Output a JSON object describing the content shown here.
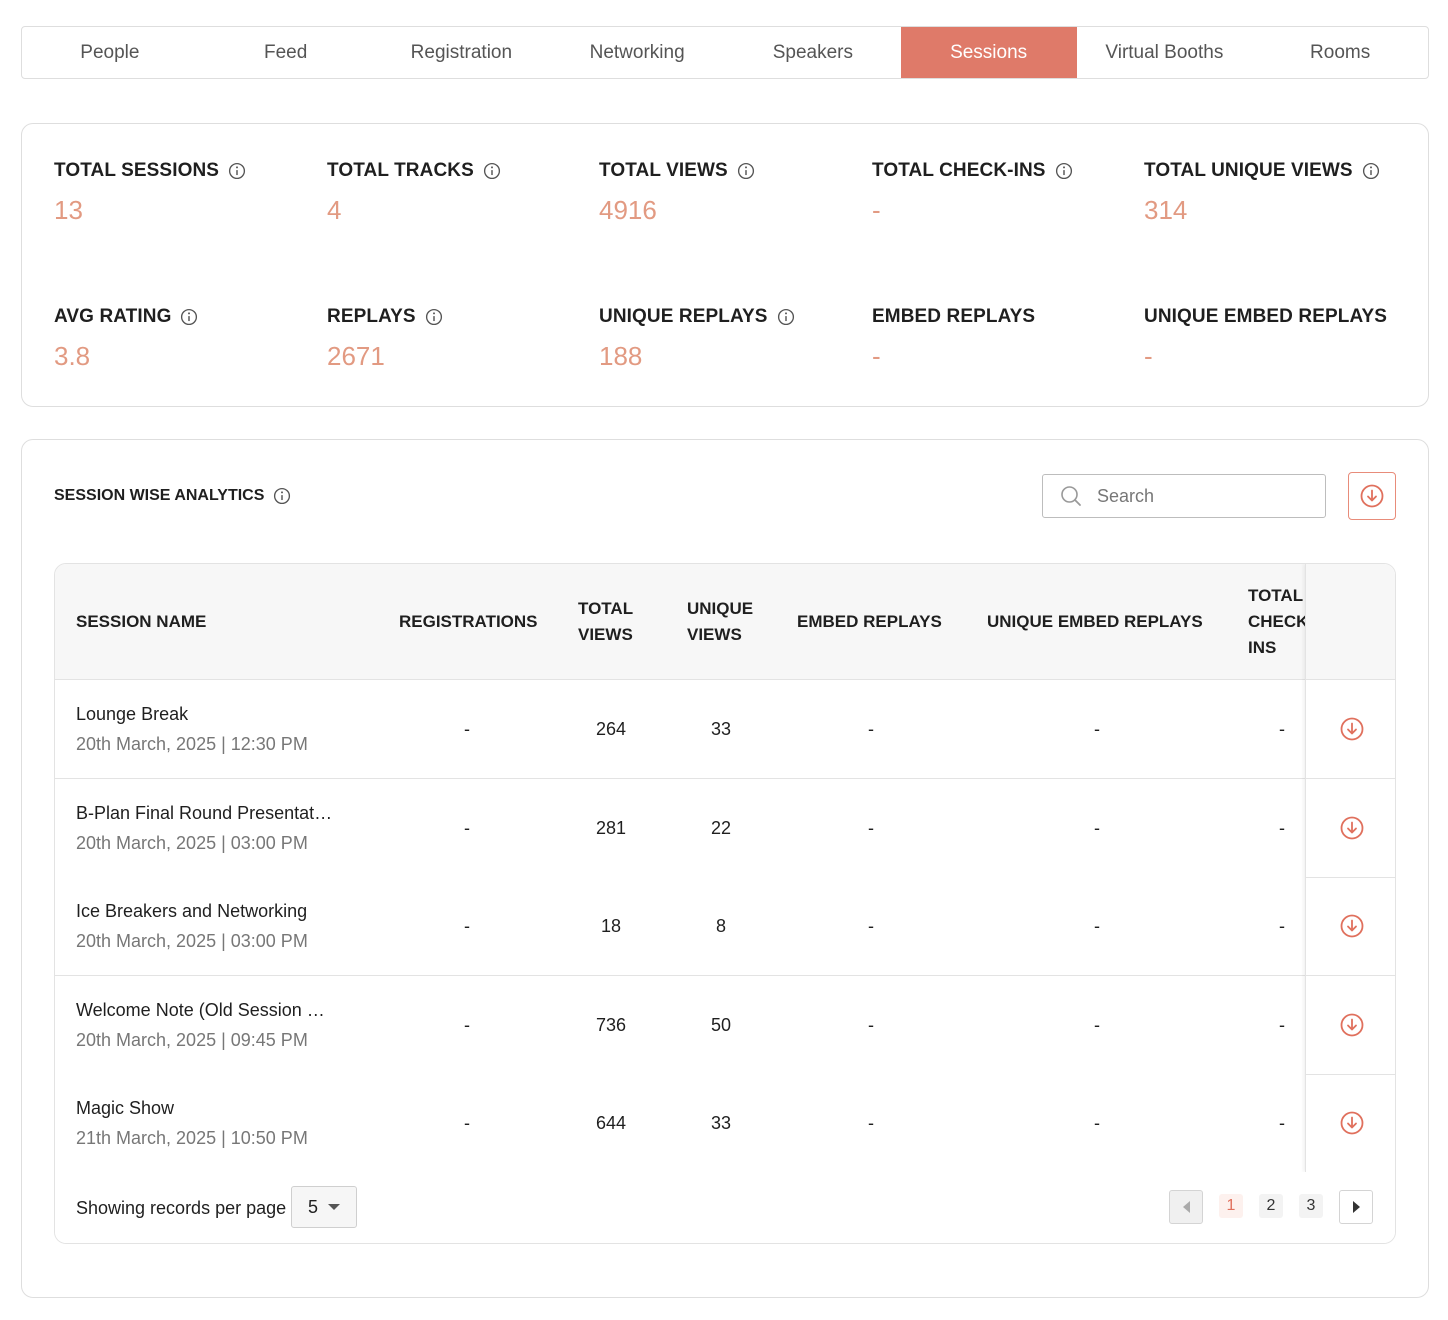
{
  "tabs": [
    {
      "label": "People",
      "active": false
    },
    {
      "label": "Feed",
      "active": false
    },
    {
      "label": "Registration",
      "active": false
    },
    {
      "label": "Networking",
      "active": false
    },
    {
      "label": "Speakers",
      "active": false
    },
    {
      "label": "Sessions",
      "active": true
    },
    {
      "label": "Virtual Booths",
      "active": false
    },
    {
      "label": "Rooms",
      "active": false
    }
  ],
  "stats": [
    {
      "label": "TOTAL SESSIONS",
      "value": "13",
      "info": true
    },
    {
      "label": "TOTAL TRACKS",
      "value": "4",
      "info": true
    },
    {
      "label": "TOTAL VIEWS",
      "value": "4916",
      "info": true
    },
    {
      "label": "TOTAL CHECK-INS",
      "value": "-",
      "info": true
    },
    {
      "label": "TOTAL UNIQUE VIEWS",
      "value": "314",
      "info": true
    },
    {
      "label": "AVG RATING",
      "value": "3.8",
      "info": true
    },
    {
      "label": "REPLAYS",
      "value": "2671",
      "info": true
    },
    {
      "label": "UNIQUE REPLAYS",
      "value": "188",
      "info": true
    },
    {
      "label": "EMBED REPLAYS",
      "value": "-",
      "info": false
    },
    {
      "label": "UNIQUE EMBED REPLAYS",
      "value": "-",
      "info": false
    }
  ],
  "analytics": {
    "title": "SESSION WISE ANALYTICS",
    "search_placeholder": "Search",
    "columns": {
      "session_name": "SESSION NAME",
      "registrations": "REGISTRATIONS",
      "total_views_1": "TOTAL",
      "total_views_2": "VIEWS",
      "unique_views_1": "UNIQUE",
      "unique_views_2": "VIEWS",
      "embed_replays": "EMBED REPLAYS",
      "unique_embed_replays": "UNIQUE EMBED REPLAYS",
      "check_ins_1": "TOTAL",
      "check_ins_2": "CHECK",
      "check_ins_3": "INS"
    },
    "rows": [
      {
        "name": "Lounge Break",
        "date": "20th March, 2025 | 12:30 PM",
        "registrations": "-",
        "total_views": "264",
        "unique_views": "33",
        "embed_replays": "-",
        "unique_embed_replays": "-",
        "check_ins": "-"
      },
      {
        "name": "B-Plan Final Round Presentat…",
        "date": "20th March, 2025 | 03:00 PM",
        "registrations": "-",
        "total_views": "281",
        "unique_views": "22",
        "embed_replays": "-",
        "unique_embed_replays": "-",
        "check_ins": "-"
      },
      {
        "name": "Ice Breakers and Networking",
        "date": "20th March, 2025 | 03:00 PM",
        "registrations": "-",
        "total_views": "18",
        "unique_views": "8",
        "embed_replays": "-",
        "unique_embed_replays": "-",
        "check_ins": "-"
      },
      {
        "name": "Welcome Note (Old Session …",
        "date": "20th March, 2025 | 09:45 PM",
        "registrations": "-",
        "total_views": "736",
        "unique_views": "50",
        "embed_replays": "-",
        "unique_embed_replays": "-",
        "check_ins": "-"
      },
      {
        "name": "Magic Show",
        "date": "21th March, 2025 | 10:50 PM",
        "registrations": "-",
        "total_views": "644",
        "unique_views": "33",
        "embed_replays": "-",
        "unique_embed_replays": "-",
        "check_ins": "-"
      }
    ],
    "footer": {
      "per_page_label": "Showing records per page",
      "per_page_value": "5",
      "pages": [
        "1",
        "2",
        "3"
      ],
      "current_page": "1"
    }
  },
  "colors": {
    "accent": "#df7a69",
    "stat_value": "#e29a82",
    "icon_accent": "#e0705d"
  },
  "icons": {
    "info": "info-circle-icon",
    "search": "search-icon",
    "download": "download-circle-icon"
  }
}
